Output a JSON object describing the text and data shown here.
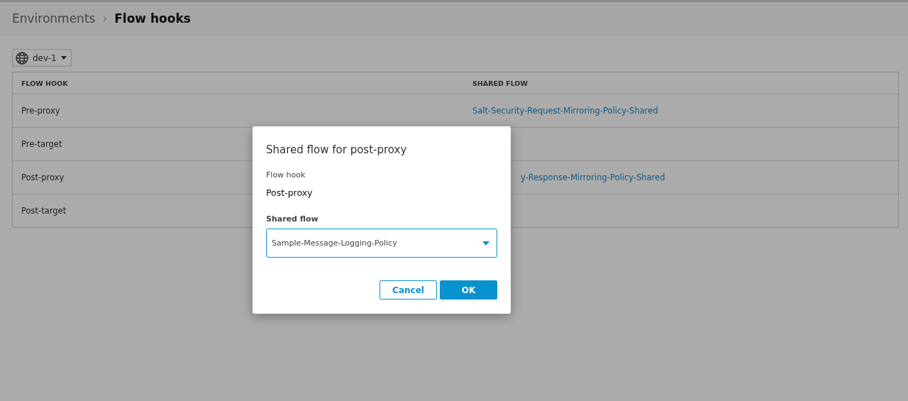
{
  "breadcrumb": {
    "parent": "Environments",
    "separator": "›",
    "current": "Flow hooks"
  },
  "environment_selector": {
    "value": "dev-1"
  },
  "table": {
    "columns": [
      "FLOW HOOK",
      "SHARED FLOW"
    ],
    "rows": [
      {
        "flow_hook": "Pre-proxy",
        "shared_flow": "Salt-Security-Request-Mirroring-Policy-Shared"
      },
      {
        "flow_hook": "Pre-target"
      },
      {
        "flow_hook": "Post-proxy",
        "shared_flow": "y-Response-Mirroring-Policy-Shared",
        "partly_hidden": true
      },
      {
        "flow_hook": "Post-target"
      }
    ]
  },
  "dialog": {
    "title": "Shared flow for post-proxy",
    "flow_hook_label": "Flow hook",
    "flow_hook_value": "Post-proxy",
    "shared_flow_label": "Shared flow",
    "shared_flow_value": "Sample-Message-Logging-Policy",
    "buttons": [
      {
        "label": "Cancel",
        "kind": "secondary"
      },
      {
        "label": "OK",
        "kind": "primary"
      }
    ]
  }
}
